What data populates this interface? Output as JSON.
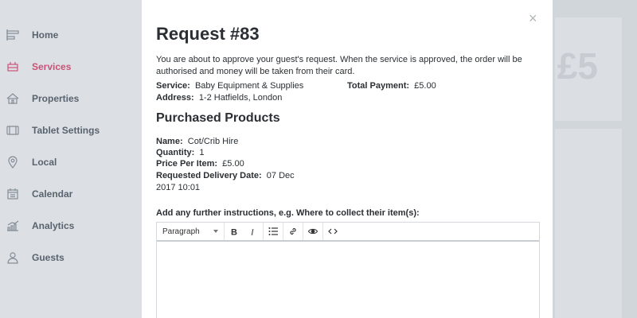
{
  "sidebar": {
    "items": [
      {
        "label": "Home",
        "icon": "home-icon"
      },
      {
        "label": "Services",
        "icon": "services-icon",
        "active": true
      },
      {
        "label": "Properties",
        "icon": "properties-icon"
      },
      {
        "label": "Tablet Settings",
        "icon": "tablet-icon"
      },
      {
        "label": "Local",
        "icon": "location-pin-icon"
      },
      {
        "label": "Calendar",
        "icon": "calendar-icon"
      },
      {
        "label": "Analytics",
        "icon": "analytics-icon"
      },
      {
        "label": "Guests",
        "icon": "user-icon"
      }
    ],
    "active_color": "#d6537a"
  },
  "background": {
    "stat_value": "£5"
  },
  "modal": {
    "close_label": "×",
    "title": "Request #83",
    "intro": "You are about to approve your guest's request. When the service is approved, the order will be authorised and money will be taken from their card.",
    "service_label": "Service:",
    "service_value": "Baby Equipment & Supplies",
    "total_label": "Total Payment:",
    "total_value": "£5.00",
    "address_label": "Address:",
    "address_value": "1-2 Hatfields, London",
    "products_title": "Purchased Products",
    "product": {
      "name_label": "Name:",
      "name_value": "Cot/Crib Hire",
      "quantity_label": "Quantity:",
      "quantity_value": "1",
      "price_label": "Price Per Item:",
      "price_value": "£5.00",
      "delivery_label": "Requested Delivery Date:",
      "delivery_value_line1": "07 Dec",
      "delivery_value_line2": "2017 10:01"
    },
    "instructions_label": "Add any further instructions, e.g. Where to collect their item(s):",
    "editor": {
      "format_select": "Paragraph",
      "buttons": [
        "bold-icon",
        "italic-icon",
        "bulleted-list-icon",
        "link-icon",
        "preview-eye-icon",
        "code-icon"
      ],
      "content": ""
    }
  }
}
